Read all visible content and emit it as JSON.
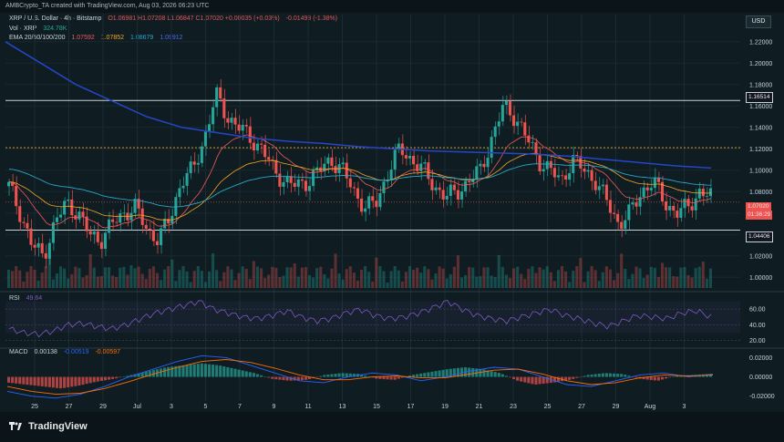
{
  "header": {
    "text": "AMBCrypto_TA created with TradingView.com, Aug 03, 2026 06:23 UTC"
  },
  "legend": {
    "title": "XRP / U.S. Dollar · 4h · Bitstamp",
    "ohlc": "O1.06981 H1.07208 L1.06847 C1.07020 +0.00035 (+0.03%)",
    "change": "-0.01498 (-1.38%)",
    "vol_label": "Vol · XRP",
    "vol_value": "324.78K",
    "ema_label": "EMA 20/50/100/200",
    "ema20": "1.07592",
    "ema50": "1.07852",
    "ema100": "1.08679",
    "ema200": "1.09912"
  },
  "currency_button": "USD",
  "price_tags": {
    "level_high": "1.16514",
    "current": "1.07020",
    "countdown": "01:36:29",
    "level_low": "1.04406"
  },
  "rsi": {
    "label": "RSI",
    "value": "49.64"
  },
  "macd": {
    "label": "MACD",
    "v1": "0.00138",
    "v2": "-0.00519",
    "v3": "-0.00597"
  },
  "brand": "TradingView",
  "colors": {
    "up": "#26a69a",
    "down": "#ef5350",
    "ema20": "#f05a5a",
    "ema50": "#f5a623",
    "ema100": "#2ba6c9",
    "ema200": "#2446c8",
    "rsi": "#7e57c2",
    "macd": "#2962ff",
    "signal": "#ff6d00"
  },
  "chart_data": {
    "type": "candlestick",
    "symbol": "XRP / U.S. Dollar",
    "interval": "4h",
    "x_tick_labels": [
      "25",
      "27",
      "29",
      "Jul",
      "3",
      "5",
      "7",
      "9",
      "11",
      "13",
      "15",
      "17",
      "19",
      "21",
      "23",
      "25",
      "27",
      "29",
      "Aug",
      "3"
    ],
    "y_ticks": [
      "1.22000",
      "1.20000",
      "1.18000",
      "1.16000",
      "1.14000",
      "1.12000",
      "1.10000",
      "1.08000",
      "1.06000",
      "1.04000",
      "1.02000",
      "1.00000"
    ],
    "ylim": [
      0.99,
      1.23
    ],
    "horizontal_levels": [
      1.16514,
      1.04406
    ],
    "dotted_level": 1.121,
    "price_path": [
      1.085,
      1.06,
      1.03,
      1.02,
      1.05,
      1.07,
      1.06,
      1.04,
      1.035,
      1.05,
      1.06,
      1.065,
      1.045,
      1.035,
      1.055,
      1.09,
      1.1,
      1.13,
      1.17,
      1.15,
      1.14,
      1.13,
      1.12,
      1.1,
      1.09,
      1.085,
      1.09,
      1.1,
      1.11,
      1.1,
      1.08,
      1.065,
      1.07,
      1.1,
      1.12,
      1.11,
      1.1,
      1.085,
      1.075,
      1.08,
      1.09,
      1.1,
      1.13,
      1.16,
      1.15,
      1.13,
      1.11,
      1.1,
      1.09,
      1.11,
      1.1,
      1.09,
      1.07,
      1.05,
      1.06,
      1.08,
      1.09,
      1.07,
      1.06,
      1.065,
      1.08,
      1.075
    ],
    "ema200_path": [
      1.22,
      1.2,
      1.18,
      1.165,
      1.15,
      1.14,
      1.135,
      1.13,
      1.127,
      1.125,
      1.122,
      1.12,
      1.118,
      1.117,
      1.116,
      1.115,
      1.113,
      1.11,
      1.107,
      1.104,
      1.102
    ],
    "rsi_ticks": [
      "60.00",
      "40.00",
      "20.00"
    ],
    "rsi_ylim": [
      15,
      80
    ],
    "rsi_path": [
      35,
      30,
      28,
      32,
      40,
      42,
      38,
      35,
      40,
      48,
      55,
      60,
      65,
      70,
      60,
      55,
      50,
      48,
      52,
      58,
      50,
      45,
      48,
      55,
      60,
      52,
      48,
      50,
      55,
      62,
      70,
      60,
      52,
      48,
      45,
      50,
      55,
      60,
      52,
      48,
      42,
      38,
      45,
      52,
      50,
      48,
      55,
      58,
      50
    ],
    "macd_ticks": [
      "0.02000",
      "0.00000",
      "-0.02000"
    ],
    "macd_ylim": [
      -0.025,
      0.027
    ],
    "macd_hist": [
      -0.006,
      -0.008,
      -0.01,
      -0.012,
      -0.009,
      -0.005,
      -0.002,
      0.002,
      0.006,
      0.01,
      0.012,
      0.014,
      0.012,
      0.008,
      0.004,
      -0.002,
      -0.004,
      -0.003,
      0.002,
      0.004,
      0.003,
      -0.002,
      -0.003,
      0.002,
      0.005,
      0.008,
      0.01,
      0.008,
      0.004,
      -0.004,
      -0.008,
      -0.006,
      -0.003,
      0.002,
      0.004,
      0.003,
      -0.002,
      -0.004,
      0.001,
      0.002,
      0.003
    ],
    "macd_line": [
      -0.015,
      -0.02,
      -0.022,
      -0.018,
      -0.01,
      0.0,
      0.008,
      0.016,
      0.022,
      0.02,
      0.012,
      0.004,
      -0.004,
      -0.006,
      0.0,
      0.004,
      0.002,
      -0.004,
      0.0,
      0.006,
      0.01,
      0.008,
      0.0,
      -0.008,
      -0.01,
      -0.004,
      0.002,
      0.004,
      0.0,
      0.003
    ],
    "signal_line": [
      -0.01,
      -0.015,
      -0.018,
      -0.017,
      -0.012,
      -0.005,
      0.003,
      0.01,
      0.016,
      0.018,
      0.015,
      0.009,
      0.002,
      -0.003,
      -0.003,
      0.0,
      0.001,
      -0.001,
      -0.001,
      0.003,
      0.007,
      0.008,
      0.003,
      -0.004,
      -0.008,
      -0.006,
      -0.001,
      0.002,
      0.001,
      0.002
    ]
  }
}
